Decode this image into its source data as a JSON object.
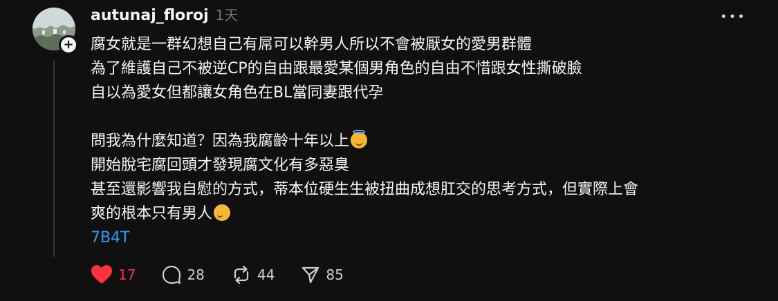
{
  "post": {
    "username": "autunaj_floroj",
    "time": "1天",
    "more": "•••",
    "lines": [
      "腐女就是一群幻想自己有屌可以幹男人所以不會被厭女的愛男群體",
      "為了維護自己不被逆CP的自由跟最愛某個男角色的自由不惜跟女性撕破臉",
      "自以為愛女但都讓女角色在BL當同妻跟代孕",
      "",
      "問我為什麼知道？因為我腐齡十年以上",
      "開始脫宅腐回頭才發現腐文化有多惡臭",
      "甚至還影響我自慰的方式，蒂本位硬生生被扭曲成想肛交的思考方式，但實際上會",
      "爽的根本只有男人"
    ],
    "tag": "7B4T"
  },
  "actions": {
    "likes": "17",
    "comments": "28",
    "reposts": "44",
    "shares": "85"
  },
  "icons": {
    "avatar": "avatar-image",
    "follow": "plus-icon",
    "more": "more-icon",
    "like": "heart-icon",
    "comment": "comment-icon",
    "repost": "repost-icon",
    "share": "send-icon",
    "emoji1": "halo-emoji-icon",
    "emoji2": "drooling-emoji-icon"
  },
  "colors": {
    "background": "#101010",
    "text": "#f3f5f7",
    "muted": "#777777",
    "link": "#2e9cff",
    "liked": "#ff3040"
  }
}
